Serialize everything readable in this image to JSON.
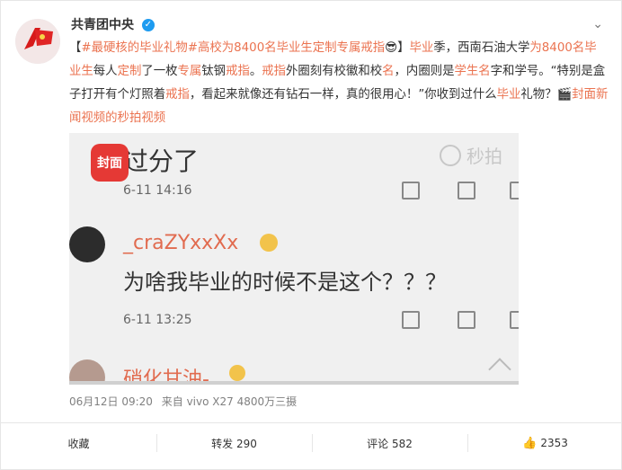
{
  "author": {
    "name": "共青团中央"
  },
  "post": {
    "segments": [
      {
        "t": "【"
      },
      {
        "t": "#最硬核的毕业礼物#",
        "c": "hashtag"
      },
      {
        "t": "高校为8400名毕业生定制专属戒指",
        "c": "orange"
      },
      {
        "t": "😎】"
      },
      {
        "t": "毕业",
        "c": "orange"
      },
      {
        "t": "季，西南石油大学"
      },
      {
        "t": "为8400名毕业生",
        "c": "orange"
      },
      {
        "t": "每人"
      },
      {
        "t": "定制",
        "c": "orange"
      },
      {
        "t": "了一枚"
      },
      {
        "t": "专属",
        "c": "orange"
      },
      {
        "t": "钛钢"
      },
      {
        "t": "戒指",
        "c": "orange"
      },
      {
        "t": "。"
      },
      {
        "t": "戒指",
        "c": "orange"
      },
      {
        "t": "外圈刻有校徽和校"
      },
      {
        "t": "名",
        "c": "orange"
      },
      {
        "t": "，内圈则是"
      },
      {
        "t": "学生名",
        "c": "orange"
      },
      {
        "t": "字和学号。“特别是盒子打开有个灯照着"
      },
      {
        "t": "戒指",
        "c": "orange"
      },
      {
        "t": "，看起来就像还有钻石一样，真的很用心！”你收到过什么"
      },
      {
        "t": "毕业",
        "c": "orange"
      },
      {
        "t": "礼物？"
      },
      {
        "t": "🎬封面新闻视频的秒拍视频",
        "c": "link"
      }
    ],
    "timestamp": "06月12日 09:20",
    "source": "来自 vivo X27 4800万三摄"
  },
  "video": {
    "line1": "过分了",
    "time1": "6-11 14:16",
    "user2": "_craZYxxXx",
    "comment2": "为啥我毕业的时候不是这个？？？",
    "time2": "6-11 13:25",
    "user3": "硝化甘油-",
    "badge": "封面",
    "watermark": "秒拍"
  },
  "actions": {
    "favorite": "收藏",
    "repost": "转发 290",
    "comment": "评论 582",
    "like": "2353"
  }
}
